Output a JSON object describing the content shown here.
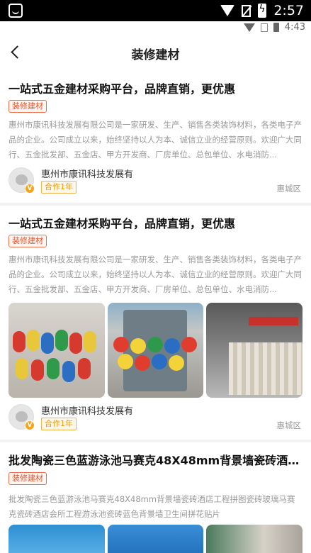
{
  "status_bar": {
    "time": "2:57"
  },
  "inner_status_bar": {
    "time": "4:43"
  },
  "nav": {
    "title": "装修建材"
  },
  "cards": [
    {
      "title": "一站式五金建材采购平台，品牌直销，更优惠",
      "tag": "装修建材",
      "description": "惠州市康讯科技发展有限公司是一家研发、生产、销售各类装饰材料，各类电子产品的企业。公司成立以来，始终坚持以人为本、诚信立业的经营原则。欢迎广大同行、五金批发部、五金店、甲方开发商、厂房单位、总包单位、水电消防...",
      "company": "惠州市康讯科技发展有",
      "cooperation": "合作1年",
      "area": "惠城区"
    },
    {
      "title": "一站式五金建材采购平台，品牌直销，更优惠",
      "tag": "装修建材",
      "description": "惠州市康讯科技发展有限公司是一家研发、生产、销售各类装饰材料，各类电子产品的企业。公司成立以来，始终坚持以人为本、诚信立业的经营原则。欢迎广大同行、五金批发部、五金店、甲方开发商、厂房单位、总包单位、水电消防...",
      "company": "惠州市康讯科技发展有",
      "cooperation": "合作1年",
      "area": "惠城区"
    },
    {
      "title": "批发陶瓷三色蓝游泳池马赛克48X48mm背景墙瓷砖酒店...",
      "description": "批发陶瓷三色蓝游泳池马赛克48X48mm背景墙瓷砖酒店工程拼图瓷砖玻璃马赛克瓷砖酒店会所工程游泳池瓷砖蓝色背景墙卫生间拼花贴片",
      "tag": "装修建材"
    }
  ]
}
